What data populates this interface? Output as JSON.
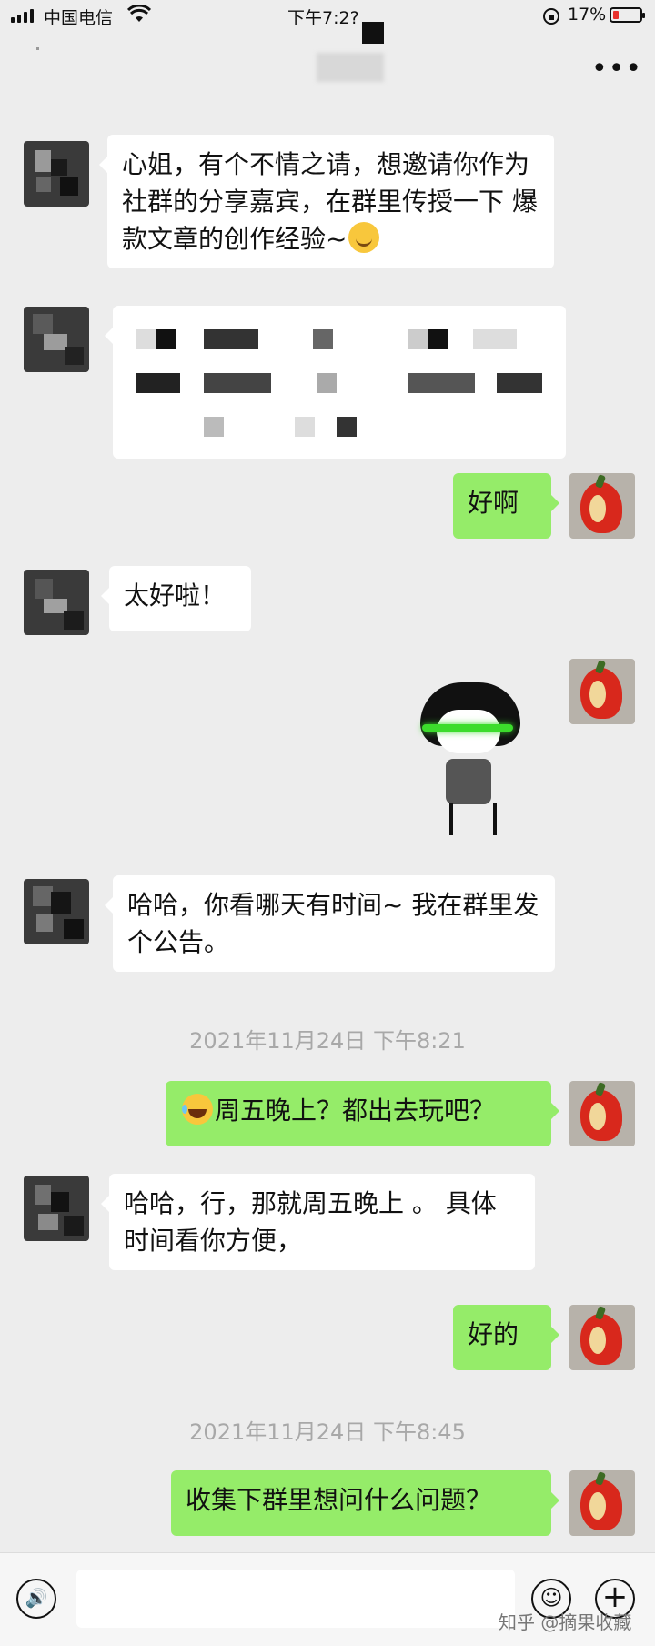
{
  "status_bar": {
    "carrier": "中国电信",
    "time": "下午7:2?",
    "battery": "17%",
    "battery_level": 0.17
  },
  "header": {
    "more": "•••"
  },
  "messages": [
    {
      "side": "left",
      "text": "心姐，有个不情之请，想邀请你作为社群的分享嘉宾，在群里传授一下 爆款文章的创作经验~"
    },
    {
      "side": "left",
      "type": "redacted"
    },
    {
      "side": "right",
      "text": "好啊"
    },
    {
      "side": "left",
      "text": "太好啦！"
    },
    {
      "side": "right",
      "type": "sticker"
    },
    {
      "side": "left",
      "text": "哈哈，你看哪天有时间~ 我在群里发个公告。"
    },
    {
      "type": "time",
      "text": "2021年11月24日 下午8:21"
    },
    {
      "side": "right",
      "text": "周五晚上？都出去玩吧？"
    },
    {
      "side": "left",
      "text": "哈哈，行，那就周五晚上 。 具体时间看你方便，"
    },
    {
      "side": "right",
      "text": "好的"
    },
    {
      "type": "time",
      "text": "2021年11月24日 下午8:45"
    },
    {
      "side": "right",
      "text": "收集下群里想问什么问题？"
    }
  ],
  "input_bar": {
    "voice": "🔊",
    "emoji": "☺",
    "plus": "+",
    "watermark": "知乎 @摘果收藏"
  },
  "colors": {
    "background": "#ededed",
    "bubble_right": "#95ec69",
    "bubble_left": "#ffffff"
  },
  "icons": [
    "signal-icon",
    "wifi-icon",
    "lock-rotation-icon",
    "battery-icon",
    "more-icon",
    "voice-icon",
    "emoji-icon",
    "plus-icon"
  ]
}
